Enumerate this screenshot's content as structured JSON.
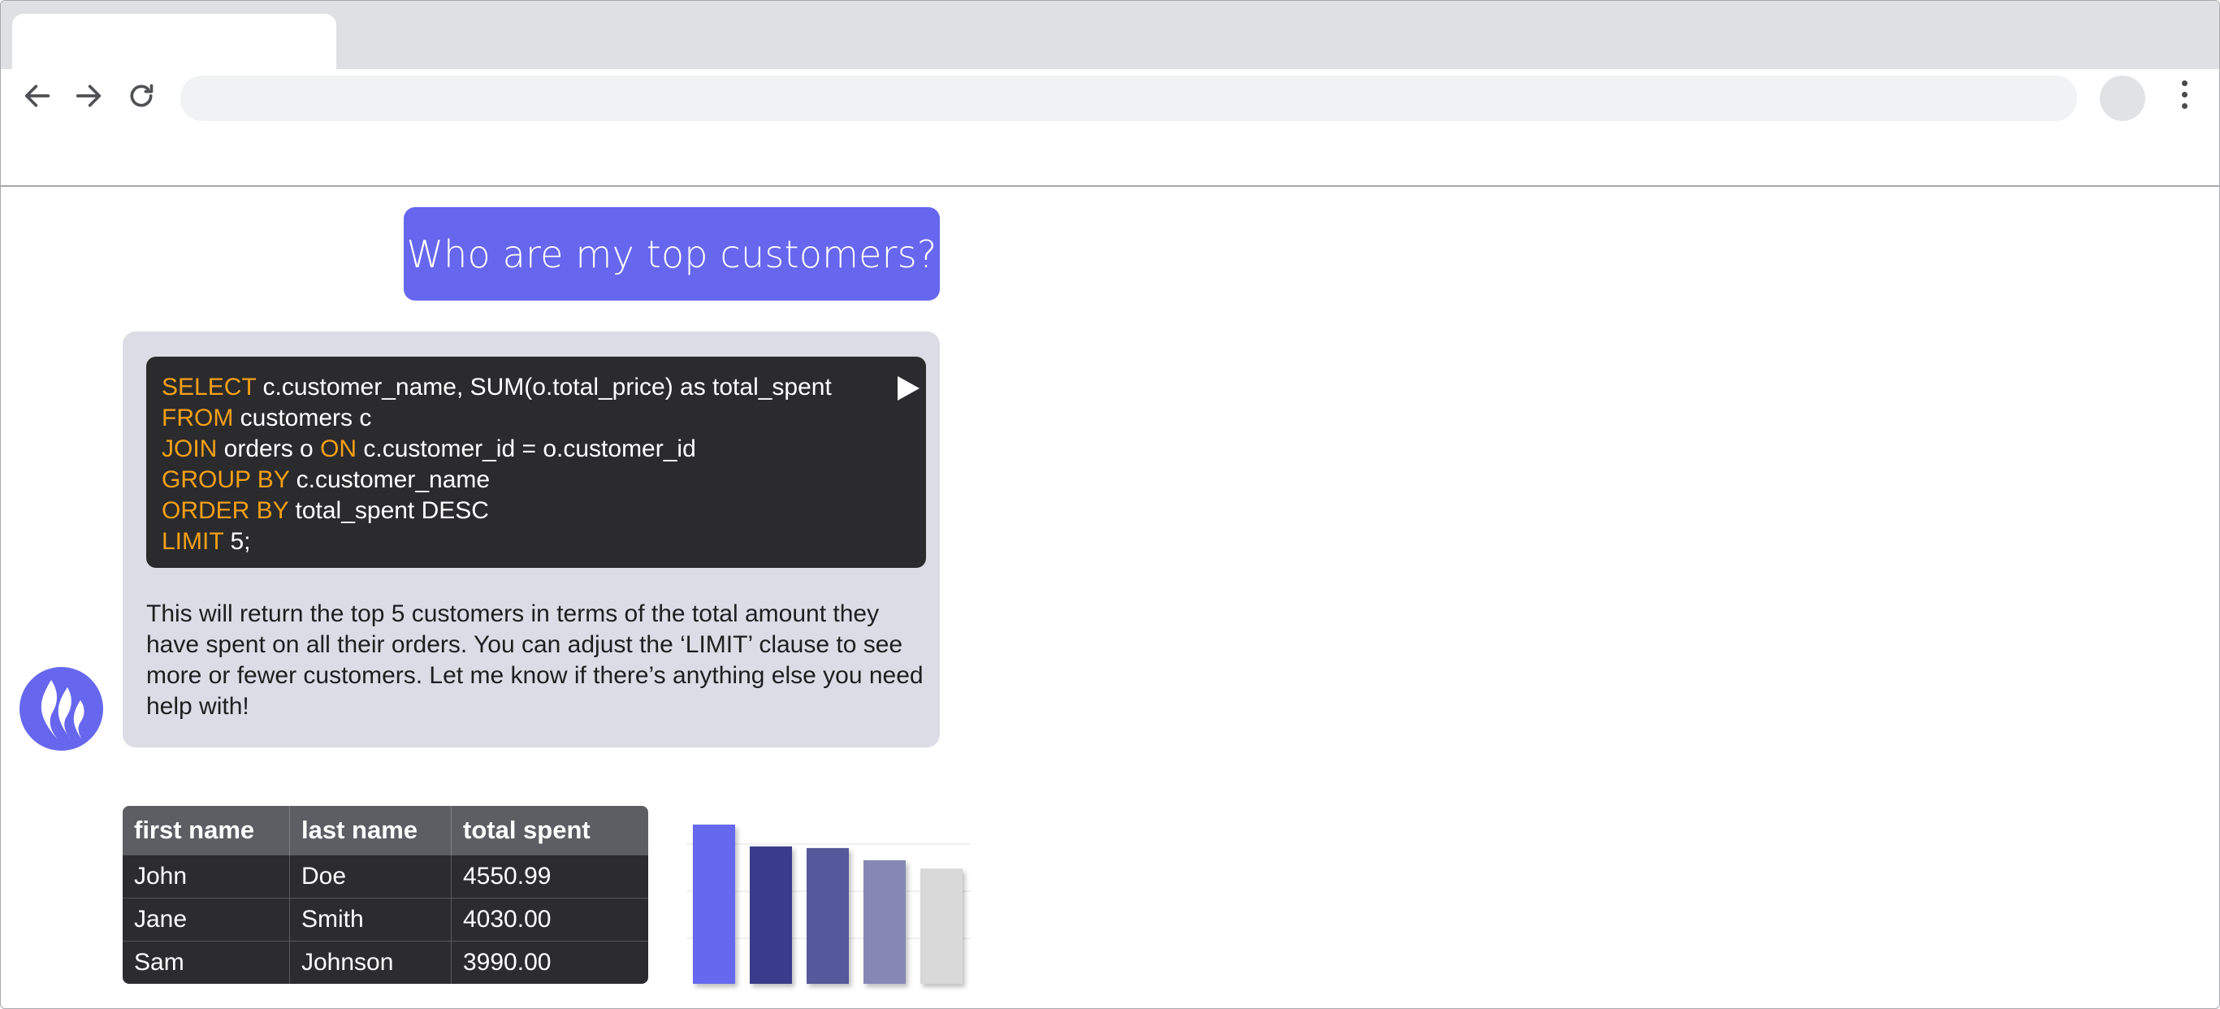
{
  "browser": {
    "back_icon": "arrow-left-icon",
    "forward_icon": "arrow-right-icon",
    "reload_icon": "reload-icon",
    "menu_icon": "kebab-menu-icon",
    "url": ""
  },
  "chat": {
    "user_message": "Who are my top customers?",
    "code_lines": [
      {
        "kw": "SELECT",
        "rest": " c.customer_name, SUM(o.total_price) as total_spent"
      },
      {
        "kw": "FROM",
        "rest": " customers c"
      },
      {
        "kw": "JOIN",
        "rest": " orders o ",
        "kw2": "ON",
        "rest2": " c.customer_id = o.customer_id"
      },
      {
        "kw": "GROUP BY",
        "rest": " c.customer_name"
      },
      {
        "kw": "ORDER BY",
        "rest": " total_spent DESC"
      },
      {
        "kw": "LIMIT",
        "rest": " 5;"
      }
    ],
    "run_icon": "play-icon",
    "assistant_icon": "flame-icon",
    "response": "This will return the top 5 customers in terms of the total amount they have spent on all their orders. You can adjust the ‘LIMIT’ clause to see more or fewer customers. Let me know if there’s anything else you need help with!"
  },
  "table": {
    "headers": [
      "first name",
      "last name",
      "total spent"
    ],
    "rows": [
      [
        "John",
        "Doe",
        "4550.99"
      ],
      [
        "Jane",
        "Smith",
        "4030.00"
      ],
      [
        "Sam",
        "Johnson",
        "3990.00"
      ]
    ]
  },
  "chart_data": {
    "type": "bar",
    "categories": [
      "",
      "",
      "",
      "",
      ""
    ],
    "values": [
      4550.99,
      4030.0,
      3990.0,
      3700,
      3500
    ],
    "colors": [
      "#6667ee",
      "#3a3b8c",
      "#55589a",
      "#8688b4",
      "#d9d9da"
    ],
    "grid": true,
    "title": "",
    "xlabel": "",
    "ylabel": ""
  },
  "colors": {
    "accent": "#6667ee",
    "keyword": "#f5a016",
    "code_bg": "#2b2b2d",
    "assistant_bubble": "#dcdce6"
  }
}
